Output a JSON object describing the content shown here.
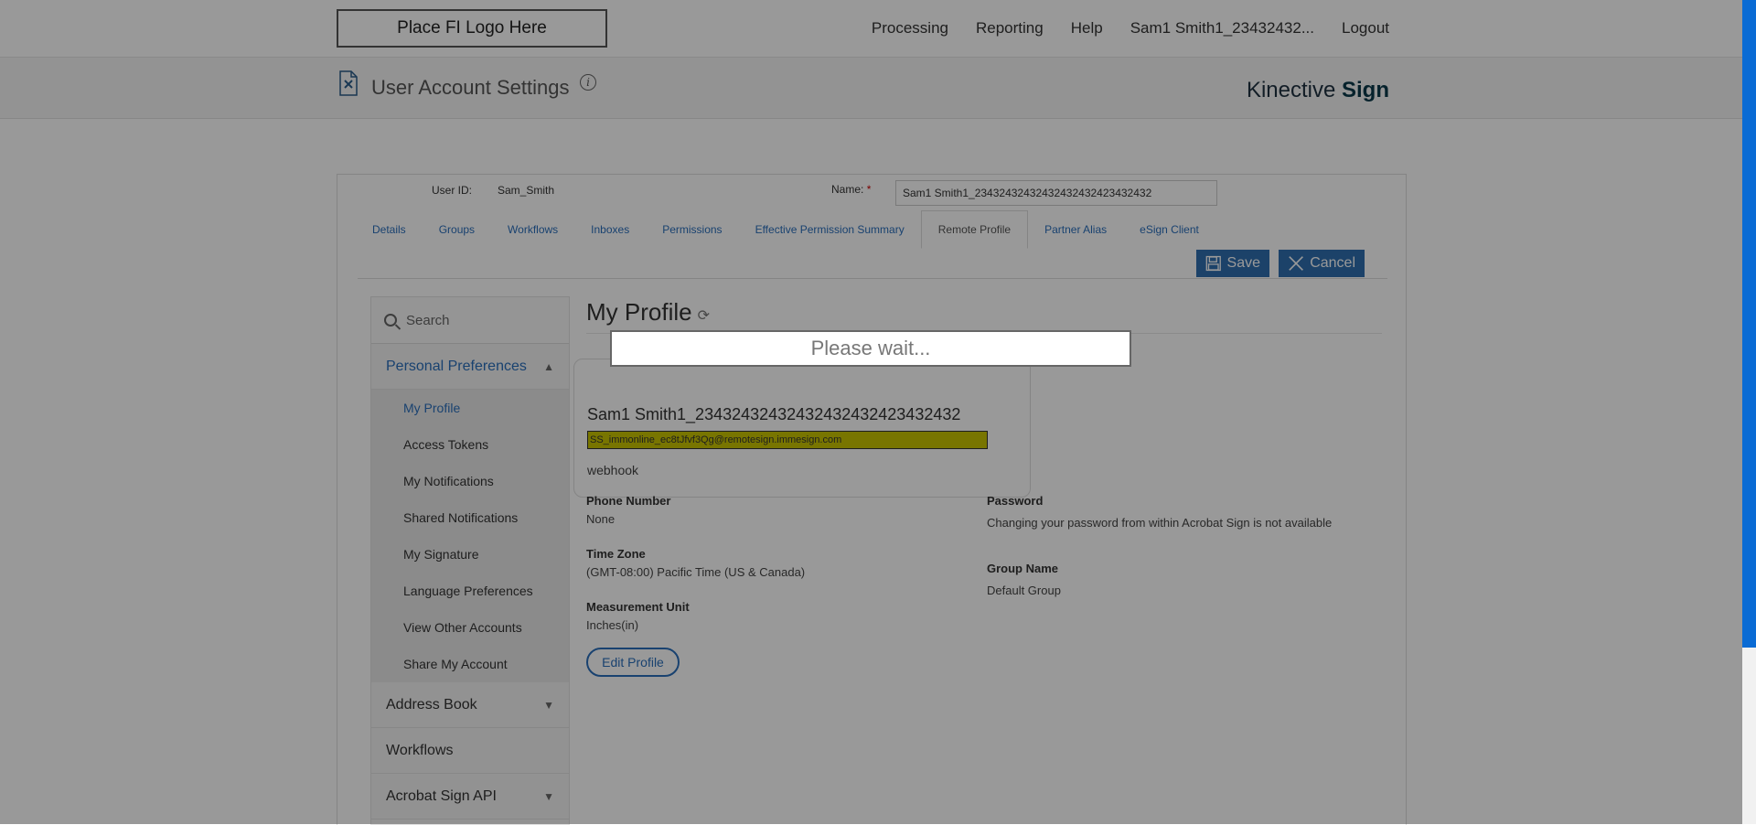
{
  "header": {
    "logo_text": "Place FI Logo Here",
    "nav": [
      "Processing",
      "Reporting",
      "Help",
      "Sam1 Smith1_23432432...",
      "Logout"
    ]
  },
  "subheader": {
    "title": "User Account Settings",
    "info_icon": "info-icon",
    "brand_prefix": "Kinective ",
    "brand_suffix": "Sign"
  },
  "account": {
    "user_id_label": "User ID:",
    "user_id": "Sam_Smith",
    "name_label": "Name:",
    "name_required_mark": "*",
    "name_value": "Sam1 Smith1_23432432432432432432423432432"
  },
  "tabs": [
    {
      "label": "Details",
      "active": false
    },
    {
      "label": "Groups",
      "active": false
    },
    {
      "label": "Workflows",
      "active": false
    },
    {
      "label": "Inboxes",
      "active": false
    },
    {
      "label": "Permissions",
      "active": false
    },
    {
      "label": "Effective Permission Summary",
      "active": false
    },
    {
      "label": "Remote Profile",
      "active": true
    },
    {
      "label": "Partner Alias",
      "active": false
    },
    {
      "label": "eSign Client",
      "active": false
    }
  ],
  "actions": {
    "save_label": "Save",
    "cancel_label": "Cancel"
  },
  "sidebar": {
    "search_placeholder": "Search",
    "sections": {
      "personal_preferences": {
        "label": "Personal Preferences",
        "items": [
          "My Profile",
          "Access Tokens",
          "My Notifications",
          "Shared Notifications",
          "My Signature",
          "Language Preferences",
          "View Other Accounts",
          "Share My Account"
        ],
        "active_item": "My Profile"
      },
      "address_book": "Address Book",
      "workflows": "Workflows",
      "acrobat_sign_api": "Acrobat Sign API"
    }
  },
  "profile": {
    "heading": "My Profile",
    "name": "Sam1 Smith1_23432432432432432432423432432",
    "email": "SS_immonline_ec8tJfvf3Qg@remotesign.immesign.com",
    "webhook": "webhook",
    "phone_label": "Phone Number",
    "phone_value": "None",
    "timezone_label": "Time Zone",
    "timezone_value": "(GMT-08:00) Pacific Time (US & Canada)",
    "measurement_label": "Measurement Unit",
    "measurement_value": "Inches(in)",
    "password_label": "Password",
    "password_value": "Changing your password from within Acrobat Sign is not available",
    "group_label": "Group Name",
    "group_value": "Default Group",
    "edit_label": "Edit Profile"
  },
  "overlay": {
    "message": "Please wait..."
  },
  "colors": {
    "accent": "#2a6ebb",
    "button": "#2f6fb0",
    "highlight": "#c8c400",
    "scrollbar": "#0a6bd4"
  }
}
